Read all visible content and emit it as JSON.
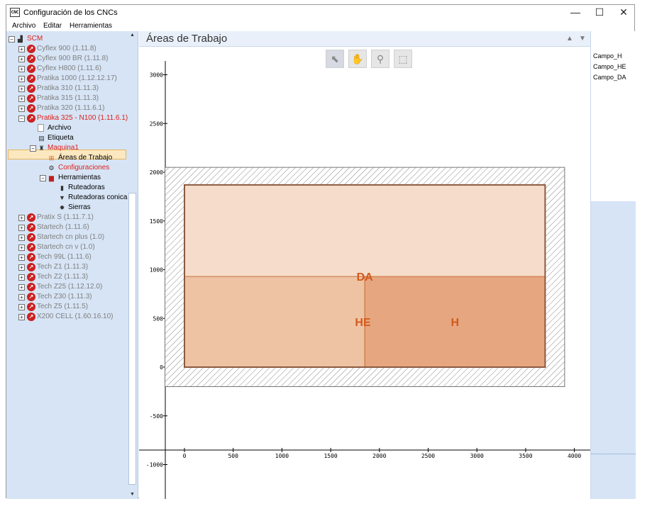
{
  "window": {
    "title": "Configuración de los CNCs",
    "icon_label": "CNC",
    "controls": {
      "minimize": "—",
      "maximize": "☐",
      "close": "✕"
    }
  },
  "menu": [
    "Archivo",
    "Editar",
    "Herramientas"
  ],
  "tree": {
    "root": "SCM",
    "machines": [
      {
        "label": "Cyflex 900 (1.11.8)"
      },
      {
        "label": "Cyflex 900 BR (1.11.8)"
      },
      {
        "label": "Cyflex H800 (1.11.6)"
      },
      {
        "label": "Pratika 1000 (1.12.12.17)"
      },
      {
        "label": "Pratika 310 (1.11.3)"
      },
      {
        "label": "Pratika 315 (1.11.3)"
      },
      {
        "label": "Pratika 320 (1.11.6.1)"
      },
      {
        "label": "Pratika 325 - N100 (1.11.6.1)"
      },
      {
        "label": "Pratix S (1.11.7.1)"
      },
      {
        "label": "Startech (1.11.6)"
      },
      {
        "label": "Startech cn plus (1.0)"
      },
      {
        "label": "Startech cn v (1.0)"
      },
      {
        "label": "Tech 99L (1.11.6)"
      },
      {
        "label": "Tech Z1 (1.11.3)"
      },
      {
        "label": "Tech Z2 (1.11.3)"
      },
      {
        "label": "Tech Z25 (1.12.12.0)"
      },
      {
        "label": "Tech Z30 (1.11.3)"
      },
      {
        "label": "Tech Z5 (1.11.5)"
      },
      {
        "label": "X200 CELL (1.60.16.10)"
      }
    ],
    "expanded_children": {
      "archivo": "Archivo",
      "etiqueta": "Etiqueta",
      "maquina": "Maquina1",
      "areas": "Áreas de Trabajo",
      "configuraciones": "Configuraciones",
      "herramientas": "Herramientas",
      "tools": [
        "Ruteadoras",
        "Ruteadoras conica",
        "Sierras"
      ]
    }
  },
  "main": {
    "title": "Áreas de Trabajo",
    "toolbar": [
      "pointer-tool",
      "pan-tool",
      "zoom-tool",
      "select-region-tool"
    ]
  },
  "chart_data": {
    "type": "area-layout",
    "x_ticks": [
      0,
      500,
      1000,
      1500,
      2000,
      2500,
      3000,
      3500,
      4000
    ],
    "y_ticks": [
      3000,
      2500,
      2000,
      1500,
      1000,
      500,
      0,
      -500,
      -1000
    ],
    "machine_table": {
      "x": [
        -200,
        3900
      ],
      "y": [
        -200,
        2050
      ]
    },
    "work_area": {
      "x": [
        0,
        3700
      ],
      "y": [
        0,
        1870
      ]
    },
    "fields": [
      {
        "name": "DA",
        "x": [
          0,
          3700
        ],
        "y": [
          0,
          1870
        ],
        "color": "#f5dccb"
      },
      {
        "name": "HE",
        "x": [
          0,
          1850
        ],
        "y": [
          0,
          930
        ],
        "color": "#eec3a4"
      },
      {
        "name": "H",
        "x": [
          1850,
          3700
        ],
        "y": [
          0,
          930
        ],
        "color": "#e6a780"
      }
    ],
    "label_color": "#d35a1c"
  },
  "right_list": [
    "Campo_H",
    "Campo_HE",
    "Campo_DA"
  ]
}
